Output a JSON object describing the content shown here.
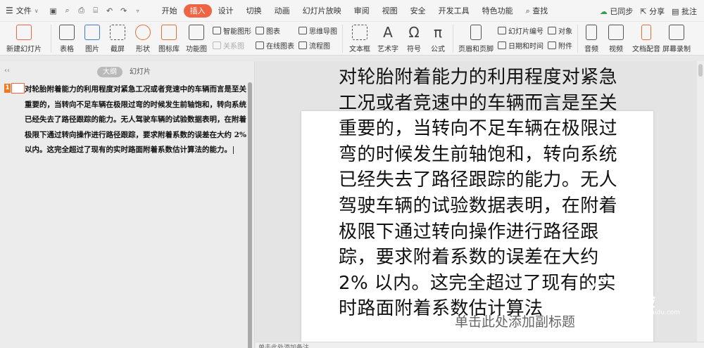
{
  "menubar": {
    "file_label": "文件",
    "tabs": [
      "开始",
      "插入",
      "设计",
      "切换",
      "动画",
      "幻灯片放映",
      "审阅",
      "视图",
      "安全",
      "开发工具",
      "特色功能"
    ],
    "active_tab": "插入",
    "search_label": "查找",
    "sync_label": "已同步",
    "share_label": "分享",
    "comment_label": "批注"
  },
  "ribbon": {
    "new_slide": "新建幻灯片",
    "table": "表格",
    "image": "图片",
    "screenshot": "截屏",
    "shape": "形状",
    "icon_lib": "图标库",
    "func_chart": "功能图",
    "smart_art": "智能图形",
    "chart": "图表",
    "mind_map": "思维导图",
    "relation": "关系图",
    "online_chart": "在线图表",
    "flowchart": "流程图",
    "textbox": "文本框",
    "wordart": "艺术字",
    "symbol": "符号",
    "formula": "公式",
    "header_footer": "页眉和页脚",
    "slide_number": "幻灯片编号",
    "object": "对象",
    "datetime": "日期和时间",
    "attachment": "附件",
    "audio": "音频",
    "video": "视频",
    "doc_audio": "文档配音",
    "screen_rec": "屏幕录制"
  },
  "left_panel": {
    "tab_outline": "大纲",
    "tab_slides": "幻灯片",
    "slide_number": "1",
    "outline_text": "对轮胎附着能力的利用程度对紧急工况或者竞速中的车辆而言是至关重要的，当转向不足车辆在极限过弯的时候发生前轴饱和，转向系统已经失去了路径跟踪的能力。无人驾驶车辆的试验数据表明，在附着极限下通过转向操作进行路径跟踪，要求附着系数的误差在大约 2% 以内。这完全超过了现有的实时路面附着系数估计算法的能力。"
  },
  "slide": {
    "title_text": "对轮胎附着能力的利用程度对紧急工况或者竞速中的车辆而言是至关重要的，当转向不足车辆在极限过弯的时候发生前轴饱和，转向系统已经失去了路径跟踪的能力。无人驾驶车辆的试验数据表明，在附着极限下通过转向操作进行路径跟踪，要求附着系数的误差在大约 2% 以内。这完全超过了现有的实时路面附着系数估计算法",
    "subtitle_placeholder": "单击此处添加副标题"
  },
  "notes": {
    "placeholder": "单击此处添加备注"
  },
  "watermark": {
    "text": "经验",
    "url": "jingyan.baidu.com"
  },
  "colors": {
    "accent": "#f06446",
    "slide_num_badge": "#f07a20"
  }
}
